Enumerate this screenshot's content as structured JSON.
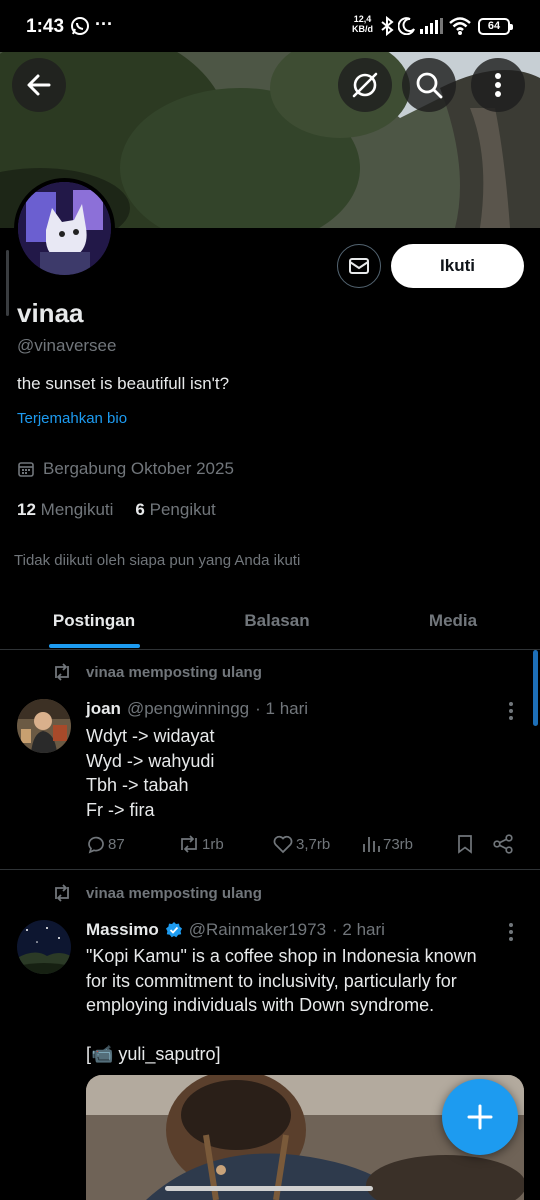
{
  "status_bar": {
    "time": "1:43",
    "more": "···",
    "net_speed_value": "12,4",
    "net_speed_unit": "KB/d",
    "battery": "64"
  },
  "profile": {
    "name": "vinaa",
    "handle": "@vinaversee",
    "bio": "the sunset is beautifull isn't?",
    "translate_bio": "Terjemahkan bio",
    "joined": "Bergabung Oktober 2025",
    "following_count": "12",
    "following_label": "Mengikuti",
    "followers_count": "6",
    "followers_label": "Pengikut",
    "followed_by": "Tidak diikuti oleh siapa pun yang Anda ikuti",
    "follow_button": "Ikuti"
  },
  "tabs": [
    {
      "label": "Postingan",
      "active": true
    },
    {
      "label": "Balasan",
      "active": false
    },
    {
      "label": "Media",
      "active": false
    }
  ],
  "posts": [
    {
      "repost_label": "vinaa memposting ulang",
      "author_name": "joan",
      "author_handle": "@pengwinningg",
      "time": "· 1 hari",
      "verified": false,
      "text": "Wdyt -> widayat\nWyd -> wahyudi\nTbh -> tabah\nFr -> fira",
      "replies": "87",
      "reposts": "1rb",
      "likes": "3,7rb",
      "views": "73rb"
    },
    {
      "repost_label": "vinaa memposting ulang",
      "author_name": "Massimo",
      "author_handle": "@Rainmaker1973",
      "time": "· 2 hari",
      "verified": true,
      "text": "\"Kopi Kamu\" is a coffee shop in Indonesia known\nfor its commitment to inclusivity, particularly for\nemploying individuals with Down syndrome.\n\n[📹 yuli_saputro]"
    }
  ],
  "colors": {
    "accent": "#1d9bf0",
    "background": "#000000",
    "text_primary": "#e7e9ea",
    "text_secondary": "#71767b",
    "divider": "#2f3336"
  },
  "icons": {
    "back": "arrow-left-icon",
    "hide": "eye-slash-icon",
    "search": "search-icon",
    "more": "vertical-dots-icon",
    "message": "envelope-icon",
    "calendar": "calendar-icon",
    "repost": "repost-icon",
    "reply": "comment-icon",
    "like": "heart-icon",
    "views": "bar-chart-icon",
    "bookmark": "bookmark-icon",
    "share": "share-icon",
    "compose": "plus-icon",
    "verified": "verified-badge-icon"
  }
}
